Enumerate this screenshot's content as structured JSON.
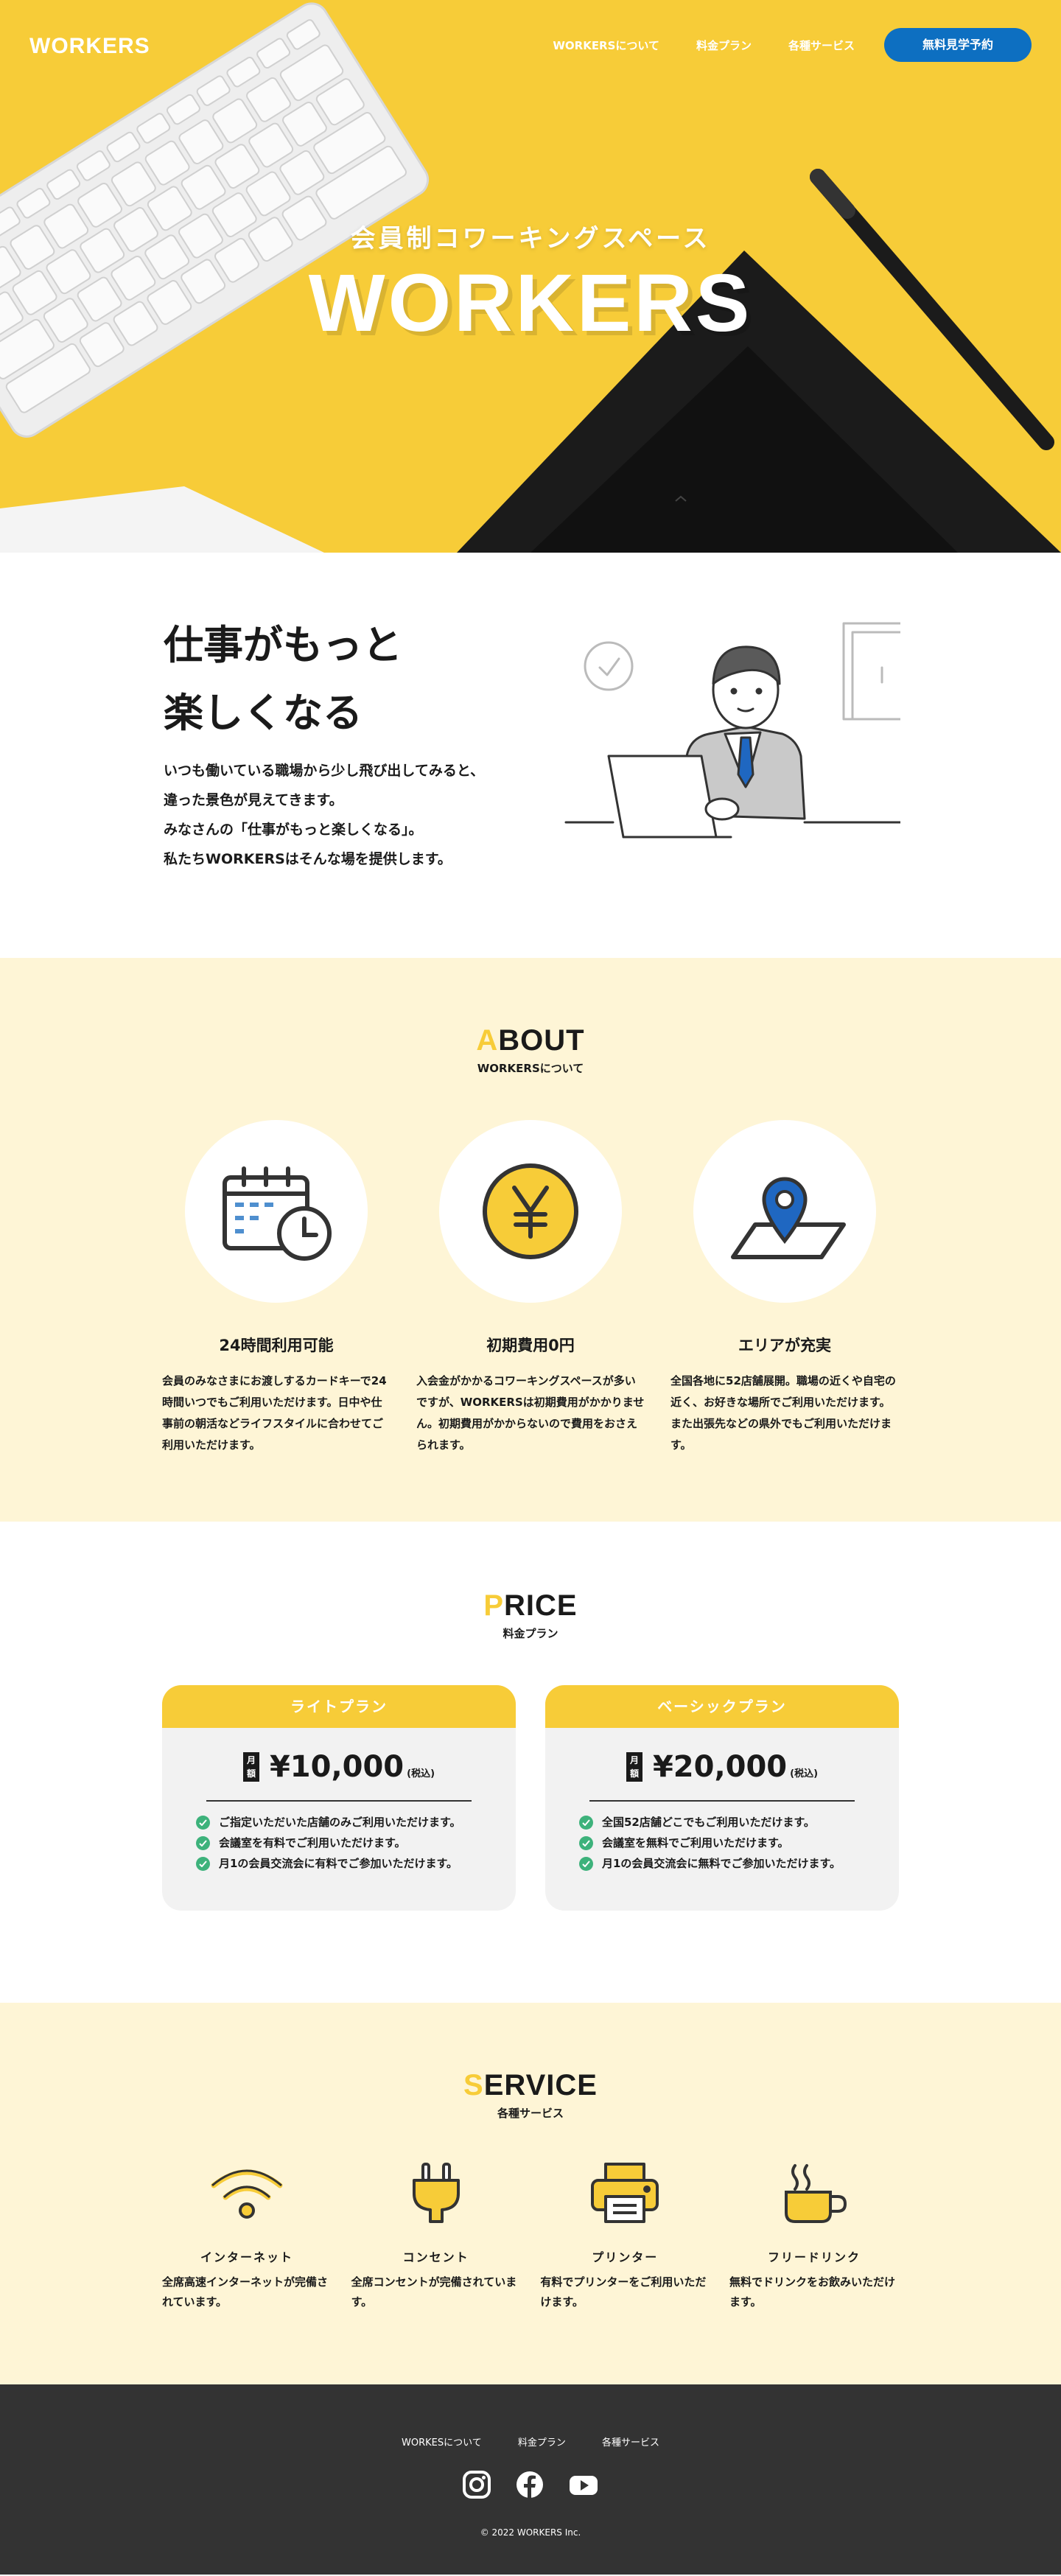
{
  "header": {
    "logo": "WORKERS",
    "nav": [
      {
        "label": "WORKERSについて"
      },
      {
        "label": "料金プラン"
      },
      {
        "label": "各種サービス"
      }
    ],
    "cta_label": "無料見学予約"
  },
  "hero": {
    "subtitle": "会員制コワーキングスペース",
    "title": "WORKERS"
  },
  "intro": {
    "heading_line1": "仕事がもっと",
    "heading_line2": "楽しくなる",
    "body": [
      "いつも働いている職場から少し飛び出してみると、",
      "違った景色が見えてきます。",
      "みなさんの「仕事がもっと楽しくなる」。",
      "私たちWORKERSはそんな場を提供します。"
    ]
  },
  "about": {
    "title_first": "A",
    "title_rest": "BOUT",
    "subtitle": "WORKERSについて",
    "items": [
      {
        "icon": "calendar-clock-icon",
        "title": "24時間利用可能",
        "text": "会員のみなさまにお渡しするカードキーで24時間いつでもご利用いただけます。日中や仕事前の朝活などライフスタイルに合わせてご利用いただけます。"
      },
      {
        "icon": "yen-coin-icon",
        "title": "初期費用0円",
        "text": "入会金がかかるコワーキングスペースが多いですが、WORKERSは初期費用がかかりません。初期費用がかからないので費用をおさえられます。"
      },
      {
        "icon": "map-pin-icon",
        "title": "エリアが充実",
        "text": "全国各地に52店舗展開。職場の近くや自宅の近く、お好きな場所でご利用いただけます。また出張先などの県外でもご利用いただけます。"
      }
    ]
  },
  "price": {
    "title_first": "P",
    "title_rest": "RICE",
    "subtitle": "料金プラン",
    "plans": [
      {
        "name": "ライトプラン",
        "tag": "月額",
        "amount": "¥10,000",
        "tax": "(税込)",
        "features": [
          "ご指定いただいた店舗のみご利用いただけます。",
          "会議室を有料でご利用いただけます。",
          "月1の会員交流会に有料でご参加いただけます。"
        ]
      },
      {
        "name": "ベーシックプラン",
        "tag": "月額",
        "amount": "¥20,000",
        "tax": "(税込)",
        "features": [
          "全国52店舗どこでもご利用いただけます。",
          "会議室を無料でご利用いただけます。",
          "月1の会員交流会に無料でご参加いただけます。"
        ]
      }
    ]
  },
  "service": {
    "title_first": "S",
    "title_rest": "ERVICE",
    "subtitle": "各種サービス",
    "items": [
      {
        "icon": "wifi-icon",
        "title": "インターネット",
        "text": "全席高速インターネットが完備されています。"
      },
      {
        "icon": "plug-icon",
        "title": "コンセント",
        "text": "全席コンセントが完備されています。"
      },
      {
        "icon": "printer-icon",
        "title": "プリンター",
        "text": "有料でプリンターをご利用いただけます。"
      },
      {
        "icon": "coffee-cup-icon",
        "title": "フリードリンク",
        "text": "無料でドリンクをお飲みいただけます。"
      }
    ]
  },
  "footer": {
    "nav": [
      {
        "label": "WORKESについて"
      },
      {
        "label": "料金プラン"
      },
      {
        "label": "各種サービス"
      }
    ],
    "social": [
      "instagram-icon",
      "facebook-icon",
      "youtube-icon"
    ],
    "copyright": "© 2022 WORKERS Inc."
  },
  "colors": {
    "accent_yellow": "#f7cc38",
    "cta_blue": "#0d6fc1",
    "section_cream": "#fef5d6",
    "footer_dark": "#333333",
    "check_green": "#3db27b"
  }
}
